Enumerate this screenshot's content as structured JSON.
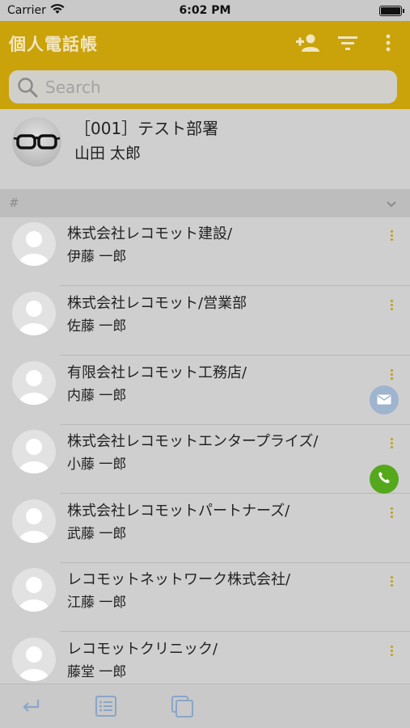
{
  "status_bar": {
    "carrier": "Carrier",
    "time": "6:02 PM"
  },
  "header": {
    "title": "個人電話帳",
    "icons": [
      "add-contact-icon",
      "filter-icon",
      "more-vertical-icon"
    ],
    "accent_color": "#caa20a"
  },
  "search": {
    "placeholder": "Search"
  },
  "my_profile": {
    "department": "［001］テスト部署",
    "name": "山田 太郎"
  },
  "section": {
    "label": "#"
  },
  "contacts": [
    {
      "company": "株式会社レコモット建設/",
      "name": "伊藤 一郎"
    },
    {
      "company": "株式会社レコモット/営業部",
      "name": "佐藤 一郎"
    },
    {
      "company": "有限会社レコモット工務店/",
      "name": "内藤 一郎"
    },
    {
      "company": "株式会社レコモットエンタープライズ/",
      "name": "小藤 一郎"
    },
    {
      "company": "株式会社レコモットパートナーズ/",
      "name": "武藤 一郎"
    },
    {
      "company": "レコモットネットワーク株式会社/",
      "name": "江藤 一郎"
    },
    {
      "company": "レコモットクリニック/",
      "name": "藤堂 一郎"
    }
  ],
  "fabs": {
    "mail_color": "#9eb4cf",
    "phone_color": "#55a81b"
  },
  "bottom_bar": {
    "icons": [
      "back-icon",
      "list-icon",
      "copy-icon"
    ]
  }
}
